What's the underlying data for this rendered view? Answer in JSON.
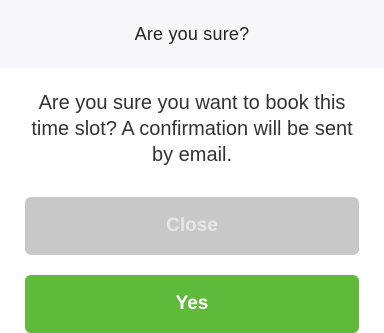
{
  "dialog": {
    "title": "Are you sure?",
    "message": "Are you sure you want to book this time slot? A confirmation will be sent by email.",
    "buttons": {
      "close_label": "Close",
      "yes_label": "Yes"
    }
  },
  "colors": {
    "header_bg": "#f7f7f9",
    "close_button_bg": "#c8c8c8",
    "yes_button_bg": "#5fba3b"
  }
}
